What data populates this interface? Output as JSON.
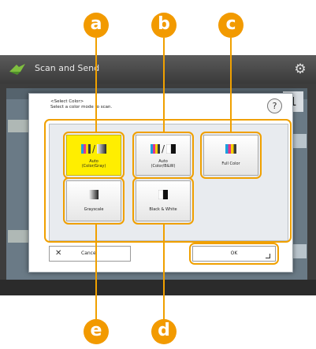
{
  "app": {
    "title": "Scan and Send",
    "count": "1"
  },
  "dialog": {
    "title_line1": "<Select Color>",
    "title_line2": "Select a color mode to scan.",
    "help_label": "?"
  },
  "options": [
    {
      "line1": "Auto",
      "line2": "(Color/Gray)",
      "selected": true
    },
    {
      "line1": "Auto",
      "line2": "(Color/B&W)",
      "selected": false
    },
    {
      "line1": "Full Color",
      "line2": "",
      "selected": false
    },
    {
      "line1": "Grayscale",
      "line2": "",
      "selected": false
    },
    {
      "line1": "Black & White",
      "line2": "",
      "selected": false
    }
  ],
  "buttons": {
    "cancel": "Cancel",
    "ok": "OK"
  },
  "callouts": {
    "a": "a",
    "b": "b",
    "c": "c",
    "d": "d",
    "e": "e"
  },
  "colors": {
    "accent": "#f29a00",
    "selected": "#ffee00"
  }
}
